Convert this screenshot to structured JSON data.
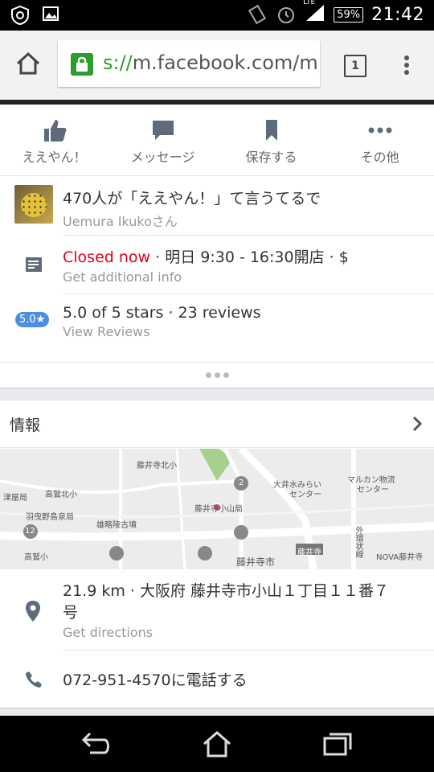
{
  "status_bar": {
    "time": "21:42",
    "battery": "59%",
    "network": "LTE"
  },
  "browser": {
    "url_scheme": "s://",
    "url_rest": "m.facebook.com/m",
    "tab_count": "1"
  },
  "actions": [
    {
      "label": "ええやん！",
      "icon": "thumbs-up-icon"
    },
    {
      "label": "メッセージ",
      "icon": "message-icon"
    },
    {
      "label": "保存する",
      "icon": "bookmark-icon"
    },
    {
      "label": "その他",
      "icon": "more-icon"
    }
  ],
  "likes": {
    "primary": "470人が「ええやん！」て言うてるで",
    "secondary": "Uemura Ikukoさん"
  },
  "hours": {
    "status": "Closed now",
    "detail": " · 明日 9:30 - 16:30開店 · $",
    "secondary": "Get additional info"
  },
  "rating": {
    "badge": "5.0★",
    "primary": "5.0 of 5 stars · 23 reviews",
    "secondary": "View Reviews"
  },
  "info": {
    "title": "情報"
  },
  "map_labels": {
    "a": "藤井寺北小",
    "b": "津屋局",
    "c": "高鷲北小",
    "d": "羽曳野島泉局",
    "e": "雄略陵古墳",
    "f": "高鷲小",
    "g": "藤井寺小山局",
    "h": "大井水みらい",
    "h2": "センター",
    "i": "マルカン物流",
    "i2": "センター",
    "j": "藤井寺",
    "k": "藤井寺市",
    "l": "NOVA藤井寺",
    "m": "外環状線",
    "n": "12",
    "o": "2"
  },
  "address": {
    "primary_line1": "21.9 km · 大阪府 藤井寺市小山１丁目１１番７",
    "primary_line2": "号",
    "secondary": "Get directions"
  },
  "phone": {
    "primary": "072-951-4570に電話する"
  }
}
